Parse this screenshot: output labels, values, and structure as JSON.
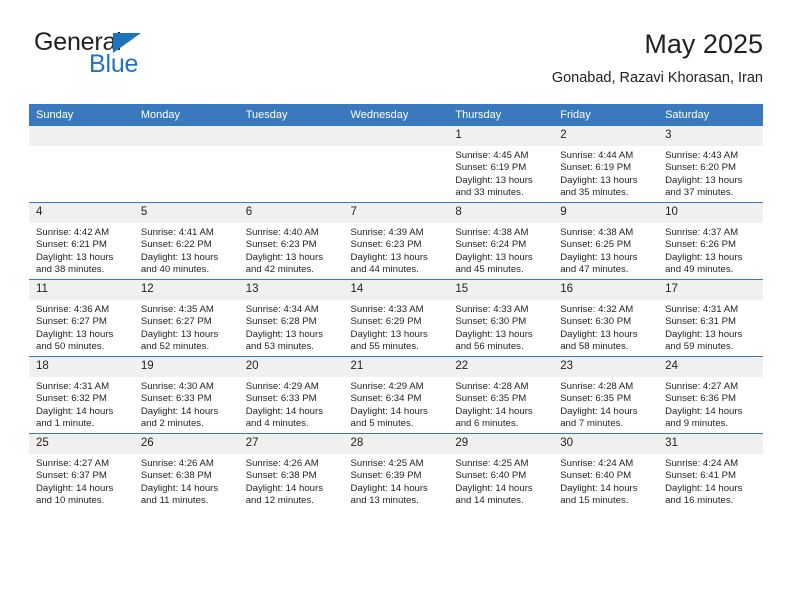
{
  "brand": {
    "name_primary": "General",
    "name_secondary": "Blue",
    "accent_color": "#1c75bc"
  },
  "header": {
    "title": "May 2025",
    "subtitle": "Gonabad, Razavi Khorasan, Iran"
  },
  "theme": {
    "header_row_bg": "#3a79bd",
    "daynum_bg": "#f0f0f0",
    "text_color": "#231f20"
  },
  "calendar": {
    "weekday_headers": [
      "Sunday",
      "Monday",
      "Tuesday",
      "Wednesday",
      "Thursday",
      "Friday",
      "Saturday"
    ],
    "labels": {
      "sunrise": "Sunrise:",
      "sunset": "Sunset:",
      "daylight": "Daylight:"
    },
    "weeks": [
      [
        {
          "day": "",
          "empty": true
        },
        {
          "day": "",
          "empty": true
        },
        {
          "day": "",
          "empty": true
        },
        {
          "day": "",
          "empty": true
        },
        {
          "day": "1",
          "sunrise": "Sunrise: 4:45 AM",
          "sunset": "Sunset: 6:19 PM",
          "daylight_l1": "Daylight: 13 hours",
          "daylight_l2": "and 33 minutes."
        },
        {
          "day": "2",
          "sunrise": "Sunrise: 4:44 AM",
          "sunset": "Sunset: 6:19 PM",
          "daylight_l1": "Daylight: 13 hours",
          "daylight_l2": "and 35 minutes."
        },
        {
          "day": "3",
          "sunrise": "Sunrise: 4:43 AM",
          "sunset": "Sunset: 6:20 PM",
          "daylight_l1": "Daylight: 13 hours",
          "daylight_l2": "and 37 minutes."
        }
      ],
      [
        {
          "day": "4",
          "sunrise": "Sunrise: 4:42 AM",
          "sunset": "Sunset: 6:21 PM",
          "daylight_l1": "Daylight: 13 hours",
          "daylight_l2": "and 38 minutes."
        },
        {
          "day": "5",
          "sunrise": "Sunrise: 4:41 AM",
          "sunset": "Sunset: 6:22 PM",
          "daylight_l1": "Daylight: 13 hours",
          "daylight_l2": "and 40 minutes."
        },
        {
          "day": "6",
          "sunrise": "Sunrise: 4:40 AM",
          "sunset": "Sunset: 6:23 PM",
          "daylight_l1": "Daylight: 13 hours",
          "daylight_l2": "and 42 minutes."
        },
        {
          "day": "7",
          "sunrise": "Sunrise: 4:39 AM",
          "sunset": "Sunset: 6:23 PM",
          "daylight_l1": "Daylight: 13 hours",
          "daylight_l2": "and 44 minutes."
        },
        {
          "day": "8",
          "sunrise": "Sunrise: 4:38 AM",
          "sunset": "Sunset: 6:24 PM",
          "daylight_l1": "Daylight: 13 hours",
          "daylight_l2": "and 45 minutes."
        },
        {
          "day": "9",
          "sunrise": "Sunrise: 4:38 AM",
          "sunset": "Sunset: 6:25 PM",
          "daylight_l1": "Daylight: 13 hours",
          "daylight_l2": "and 47 minutes."
        },
        {
          "day": "10",
          "sunrise": "Sunrise: 4:37 AM",
          "sunset": "Sunset: 6:26 PM",
          "daylight_l1": "Daylight: 13 hours",
          "daylight_l2": "and 49 minutes."
        }
      ],
      [
        {
          "day": "11",
          "sunrise": "Sunrise: 4:36 AM",
          "sunset": "Sunset: 6:27 PM",
          "daylight_l1": "Daylight: 13 hours",
          "daylight_l2": "and 50 minutes."
        },
        {
          "day": "12",
          "sunrise": "Sunrise: 4:35 AM",
          "sunset": "Sunset: 6:27 PM",
          "daylight_l1": "Daylight: 13 hours",
          "daylight_l2": "and 52 minutes."
        },
        {
          "day": "13",
          "sunrise": "Sunrise: 4:34 AM",
          "sunset": "Sunset: 6:28 PM",
          "daylight_l1": "Daylight: 13 hours",
          "daylight_l2": "and 53 minutes."
        },
        {
          "day": "14",
          "sunrise": "Sunrise: 4:33 AM",
          "sunset": "Sunset: 6:29 PM",
          "daylight_l1": "Daylight: 13 hours",
          "daylight_l2": "and 55 minutes."
        },
        {
          "day": "15",
          "sunrise": "Sunrise: 4:33 AM",
          "sunset": "Sunset: 6:30 PM",
          "daylight_l1": "Daylight: 13 hours",
          "daylight_l2": "and 56 minutes."
        },
        {
          "day": "16",
          "sunrise": "Sunrise: 4:32 AM",
          "sunset": "Sunset: 6:30 PM",
          "daylight_l1": "Daylight: 13 hours",
          "daylight_l2": "and 58 minutes."
        },
        {
          "day": "17",
          "sunrise": "Sunrise: 4:31 AM",
          "sunset": "Sunset: 6:31 PM",
          "daylight_l1": "Daylight: 13 hours",
          "daylight_l2": "and 59 minutes."
        }
      ],
      [
        {
          "day": "18",
          "sunrise": "Sunrise: 4:31 AM",
          "sunset": "Sunset: 6:32 PM",
          "daylight_l1": "Daylight: 14 hours",
          "daylight_l2": "and 1 minute."
        },
        {
          "day": "19",
          "sunrise": "Sunrise: 4:30 AM",
          "sunset": "Sunset: 6:33 PM",
          "daylight_l1": "Daylight: 14 hours",
          "daylight_l2": "and 2 minutes."
        },
        {
          "day": "20",
          "sunrise": "Sunrise: 4:29 AM",
          "sunset": "Sunset: 6:33 PM",
          "daylight_l1": "Daylight: 14 hours",
          "daylight_l2": "and 4 minutes."
        },
        {
          "day": "21",
          "sunrise": "Sunrise: 4:29 AM",
          "sunset": "Sunset: 6:34 PM",
          "daylight_l1": "Daylight: 14 hours",
          "daylight_l2": "and 5 minutes."
        },
        {
          "day": "22",
          "sunrise": "Sunrise: 4:28 AM",
          "sunset": "Sunset: 6:35 PM",
          "daylight_l1": "Daylight: 14 hours",
          "daylight_l2": "and 6 minutes."
        },
        {
          "day": "23",
          "sunrise": "Sunrise: 4:28 AM",
          "sunset": "Sunset: 6:35 PM",
          "daylight_l1": "Daylight: 14 hours",
          "daylight_l2": "and 7 minutes."
        },
        {
          "day": "24",
          "sunrise": "Sunrise: 4:27 AM",
          "sunset": "Sunset: 6:36 PM",
          "daylight_l1": "Daylight: 14 hours",
          "daylight_l2": "and 9 minutes."
        }
      ],
      [
        {
          "day": "25",
          "sunrise": "Sunrise: 4:27 AM",
          "sunset": "Sunset: 6:37 PM",
          "daylight_l1": "Daylight: 14 hours",
          "daylight_l2": "and 10 minutes."
        },
        {
          "day": "26",
          "sunrise": "Sunrise: 4:26 AM",
          "sunset": "Sunset: 6:38 PM",
          "daylight_l1": "Daylight: 14 hours",
          "daylight_l2": "and 11 minutes."
        },
        {
          "day": "27",
          "sunrise": "Sunrise: 4:26 AM",
          "sunset": "Sunset: 6:38 PM",
          "daylight_l1": "Daylight: 14 hours",
          "daylight_l2": "and 12 minutes."
        },
        {
          "day": "28",
          "sunrise": "Sunrise: 4:25 AM",
          "sunset": "Sunset: 6:39 PM",
          "daylight_l1": "Daylight: 14 hours",
          "daylight_l2": "and 13 minutes."
        },
        {
          "day": "29",
          "sunrise": "Sunrise: 4:25 AM",
          "sunset": "Sunset: 6:40 PM",
          "daylight_l1": "Daylight: 14 hours",
          "daylight_l2": "and 14 minutes."
        },
        {
          "day": "30",
          "sunrise": "Sunrise: 4:24 AM",
          "sunset": "Sunset: 6:40 PM",
          "daylight_l1": "Daylight: 14 hours",
          "daylight_l2": "and 15 minutes."
        },
        {
          "day": "31",
          "sunrise": "Sunrise: 4:24 AM",
          "sunset": "Sunset: 6:41 PM",
          "daylight_l1": "Daylight: 14 hours",
          "daylight_l2": "and 16 minutes."
        }
      ]
    ]
  }
}
